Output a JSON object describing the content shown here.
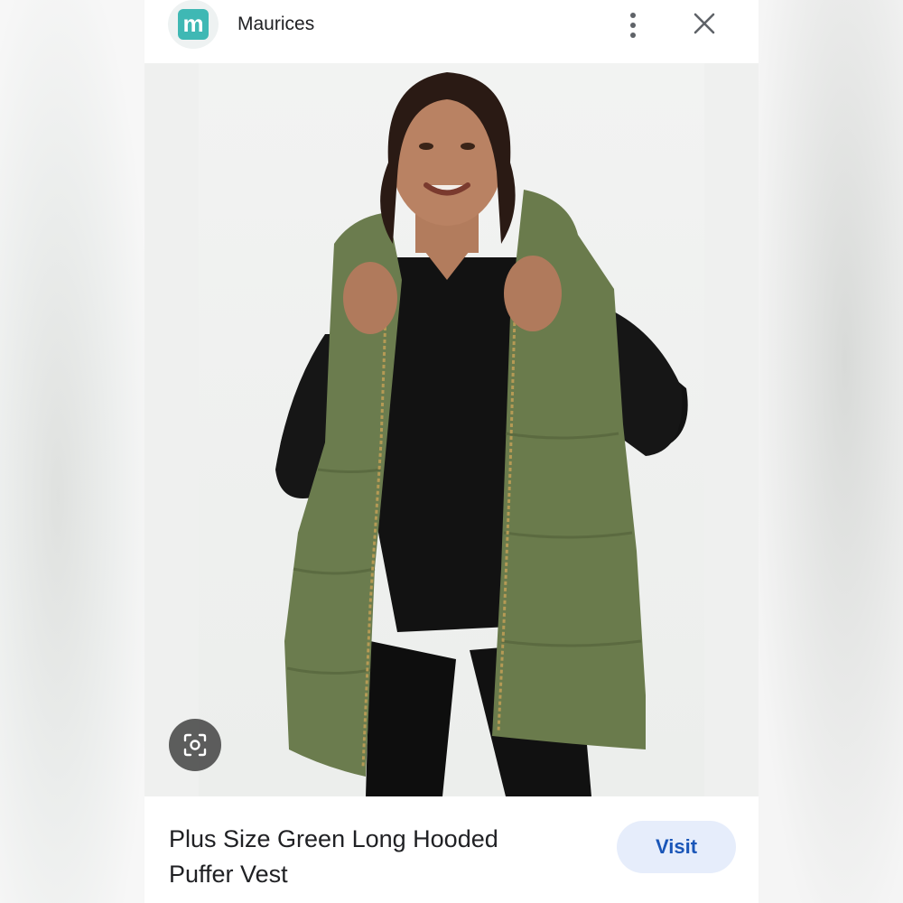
{
  "header": {
    "brand_name": "Maurices",
    "logo_letter": "m",
    "more_icon": "more-vert-icon",
    "close_icon": "close-icon"
  },
  "product": {
    "title": "Plus Size Green Long Hooded Puffer Vest",
    "visit_label": "Visit"
  },
  "icons": {
    "lens": "lens-search-icon"
  },
  "colors": {
    "accent": "#1a56b8",
    "visit_bg": "#e6edfb",
    "logo": "#3fb8b4",
    "vest": "#6b7c4e"
  }
}
